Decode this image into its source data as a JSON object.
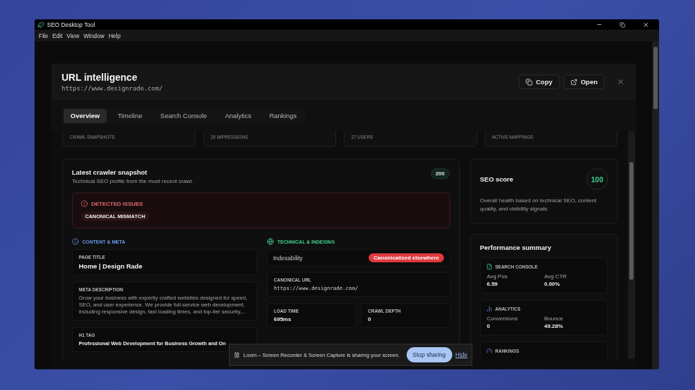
{
  "window": {
    "title": "SEO Desktop Tool"
  },
  "menu": [
    "File",
    "Edit",
    "View",
    "Window",
    "Help"
  ],
  "modal": {
    "title": "URL intelligence",
    "url": "https://www.designrade.com/",
    "actions": [
      {
        "label": "Copy",
        "kind": "copy"
      },
      {
        "label": "Open",
        "kind": "open"
      }
    ]
  },
  "tabs": [
    {
      "label": "Overview",
      "selected": true
    },
    {
      "label": "Timeline",
      "selected": false
    },
    {
      "label": "Search Console",
      "selected": false
    },
    {
      "label": "Analytics",
      "selected": false
    },
    {
      "label": "Rankings",
      "selected": false
    }
  ],
  "stats": [
    "CRAWL SNAPSHOTS",
    "29 IMPRESSIONS",
    "27 USERS",
    "ACTIVE MAPPINGS"
  ],
  "snapshot": {
    "title": "Latest crawler snapshot",
    "subtitle": "Technical SEO profile from the most recent crawl.",
    "status": "200",
    "issues": {
      "title": "DETECTED ISSUES",
      "tags": [
        "CANONICAL MISMATCH"
      ]
    },
    "content_meta": {
      "heading": "CONTENT & META",
      "fields": [
        {
          "kind": "title",
          "label": "PAGE TITLE",
          "value": "Home | Design Rade"
        },
        {
          "kind": "text",
          "label": "META DESCRIPTION",
          "value": "Grow your business with expertly crafted websites designed for speed, SEO, and user experience. We provide full-service web development, including responsive design, fast loading times, and top-tier security,..."
        },
        {
          "kind": "heading",
          "label": "H1 TAG",
          "value": "Professional Web Development for Business Growth and On"
        }
      ]
    },
    "technical": {
      "heading": "TECHNICAL & INDEXING",
      "indexability": {
        "label": "Indexability",
        "badge": "Canonicalized elsewhere"
      },
      "canonical": {
        "label": "CANONICAL URL",
        "value": "https://www.designrade.com/"
      },
      "metrics": [
        {
          "label": "LOAD TIME",
          "value": "695ms"
        },
        {
          "label": "CRAWL DEPTH",
          "value": "0"
        }
      ]
    }
  },
  "seo_score": {
    "title": "SEO score",
    "score": "100",
    "description": "Overall health based on technical SEO, content quality, and visibility signals."
  },
  "performance": {
    "title": "Performance summary",
    "sections": [
      {
        "kind": "search_console",
        "title": "SEARCH CONSOLE",
        "metrics": [
          {
            "label": "Avg Pos",
            "value": "6.59"
          },
          {
            "label": "Avg CTR",
            "value": "0.00%"
          }
        ]
      },
      {
        "kind": "analytics",
        "title": "ANALYTICS",
        "metrics": [
          {
            "label": "Conversions",
            "value": "0"
          },
          {
            "label": "Bounce",
            "value": "49.28%"
          }
        ]
      },
      {
        "kind": "rankings",
        "title": "RANKINGS"
      }
    ]
  },
  "notification": {
    "text": "Loom – Screen Recorder & Screen Capture is sharing your screen.",
    "button": "Stop sharing",
    "link": "Hide"
  }
}
